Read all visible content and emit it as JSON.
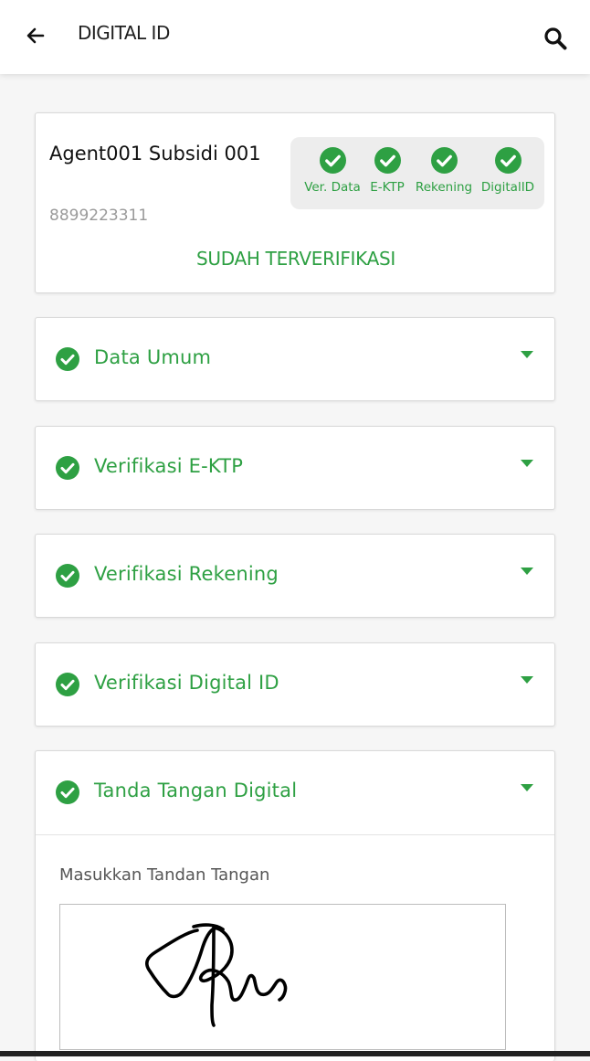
{
  "header": {
    "title": "DIGITAL ID",
    "back_icon": "arrow-left-icon",
    "search_icon": "search-icon"
  },
  "agent": {
    "name": "Agent001 Subsidi 001",
    "phone": "8899223311",
    "status": "SUDAH TERVERIFIKASI",
    "steps": [
      {
        "label": "Ver. Data",
        "done": true
      },
      {
        "label": "E-KTP",
        "done": true
      },
      {
        "label": "Rekening",
        "done": true
      },
      {
        "label": "DigitalID",
        "done": true
      }
    ]
  },
  "sections": [
    {
      "title": "Data Umum",
      "verified": true,
      "expanded": false
    },
    {
      "title": "Verifikasi E-KTP",
      "verified": true,
      "expanded": false
    },
    {
      "title": "Verifikasi Rekening",
      "verified": true,
      "expanded": false
    },
    {
      "title": "Verifikasi Digital ID",
      "verified": true,
      "expanded": false
    },
    {
      "title": "Tanda Tangan Digital",
      "verified": true,
      "expanded": true
    }
  ],
  "signature": {
    "label": "Masukkan Tandan Tangan"
  },
  "colors": {
    "accent": "#2ea043",
    "step_bg": "#ededed",
    "muted_text": "#9a9a9a"
  }
}
